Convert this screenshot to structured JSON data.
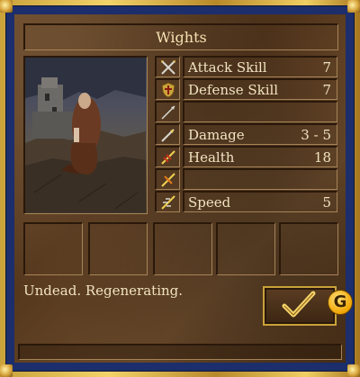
{
  "window": {
    "title": "Wights"
  },
  "stats": [
    {
      "icon": "attack-skill-icon",
      "label": "Attack Skill",
      "value": "7"
    },
    {
      "icon": "defense-skill-icon",
      "label": "Defense Skill",
      "value": "7"
    },
    {
      "icon": "shots-icon",
      "label": "",
      "value": ""
    },
    {
      "icon": "damage-icon",
      "label": "Damage",
      "value": "3 - 5"
    },
    {
      "icon": "health-icon",
      "label": "Health",
      "value": "18"
    },
    {
      "icon": "health-left-icon",
      "label": "",
      "value": ""
    },
    {
      "icon": "speed-icon",
      "label": "Speed",
      "value": "5"
    }
  ],
  "abilities": "Undead.  Regenerating.",
  "ok_button": {
    "glyph": "✓"
  },
  "badge": {
    "text": "G"
  }
}
